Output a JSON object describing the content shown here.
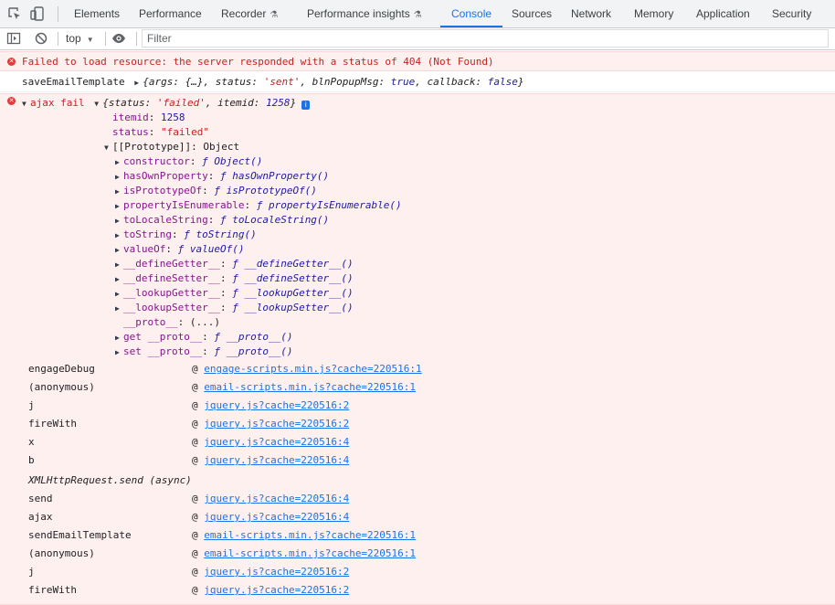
{
  "toolbar": {
    "tabs": [
      "Elements",
      "Performance",
      "Recorder",
      "Performance insights",
      "Console",
      "Sources",
      "Network",
      "Memory",
      "Application",
      "Security"
    ],
    "active_tab": "Console",
    "flask_glyph": "⚗"
  },
  "filter_bar": {
    "context": "top",
    "filter_placeholder": "Filter"
  },
  "console": {
    "error1": "Failed to load resource: the server responded with a status of 404 (Not Found)",
    "log1": {
      "label": "saveEmailTemplate",
      "summary_open": "{args: ",
      "summary_args": "{…}",
      "summary_mid1": ", status: ",
      "summary_status": "'sent'",
      "summary_mid2": ", blnPopupMsg: ",
      "summary_popup": "true",
      "summary_mid3": ", callback: ",
      "summary_cb": "false",
      "summary_close": "}"
    },
    "error2": {
      "label": "ajax fail",
      "summary_open": "{status: ",
      "summary_status": "'failed'",
      "summary_mid": ", itemid: ",
      "summary_itemid": "1258",
      "summary_close": "}",
      "info_glyph": "i",
      "props": [
        {
          "key": "itemid",
          "value": "1258"
        },
        {
          "key": "status",
          "value": "\"failed\""
        }
      ],
      "prototype_label": "[[Prototype]]: Object",
      "proto_members": [
        {
          "key": "constructor",
          "fn": "Object()"
        },
        {
          "key": "hasOwnProperty",
          "fn": "hasOwnProperty()"
        },
        {
          "key": "isPrototypeOf",
          "fn": "isPrototypeOf()"
        },
        {
          "key": "propertyIsEnumerable",
          "fn": "propertyIsEnumerable()"
        },
        {
          "key": "toLocaleString",
          "fn": "toLocaleString()"
        },
        {
          "key": "toString",
          "fn": "toString()"
        },
        {
          "key": "valueOf",
          "fn": "valueOf()"
        },
        {
          "key": "__defineGetter__",
          "fn": "__defineGetter__()"
        },
        {
          "key": "__defineSetter__",
          "fn": "__defineSetter__()"
        },
        {
          "key": "__lookupGetter__",
          "fn": "__lookupGetter__()"
        },
        {
          "key": "__lookupSetter__",
          "fn": "__lookupSetter__()"
        }
      ],
      "proto_getter_key": "__proto__",
      "proto_getter_value": "(...)",
      "proto_get": {
        "key": "get __proto__",
        "fn": "__proto__()"
      },
      "proto_set": {
        "key": "set __proto__",
        "fn": "__proto__()"
      },
      "fn_glyph": "ƒ",
      "stack": [
        {
          "fn": "engageDebug",
          "at": "@",
          "link": "engage-scripts.min.js?cache=220516:1"
        },
        {
          "fn": "(anonymous)",
          "at": "@",
          "link": "email-scripts.min.js?cache=220516:1"
        },
        {
          "fn": "j",
          "at": "@",
          "link": "jquery.js?cache=220516:2"
        },
        {
          "fn": "fireWith",
          "at": "@",
          "link": "jquery.js?cache=220516:2"
        },
        {
          "fn": "x",
          "at": "@",
          "link": "jquery.js?cache=220516:4"
        },
        {
          "fn": "b",
          "at": "@",
          "link": "jquery.js?cache=220516:4"
        },
        {
          "async": "XMLHttpRequest.send (async)"
        },
        {
          "fn": "send",
          "at": "@",
          "link": "jquery.js?cache=220516:4"
        },
        {
          "fn": "ajax",
          "at": "@",
          "link": "jquery.js?cache=220516:4"
        },
        {
          "fn": "sendEmailTemplate",
          "at": "@",
          "link": "email-scripts.min.js?cache=220516:1"
        },
        {
          "fn": "(anonymous)",
          "at": "@",
          "link": "email-scripts.min.js?cache=220516:1"
        },
        {
          "fn": "j",
          "at": "@",
          "link": "jquery.js?cache=220516:2"
        },
        {
          "fn": "fireWith",
          "at": "@",
          "link": "jquery.js?cache=220516:2"
        }
      ]
    }
  }
}
